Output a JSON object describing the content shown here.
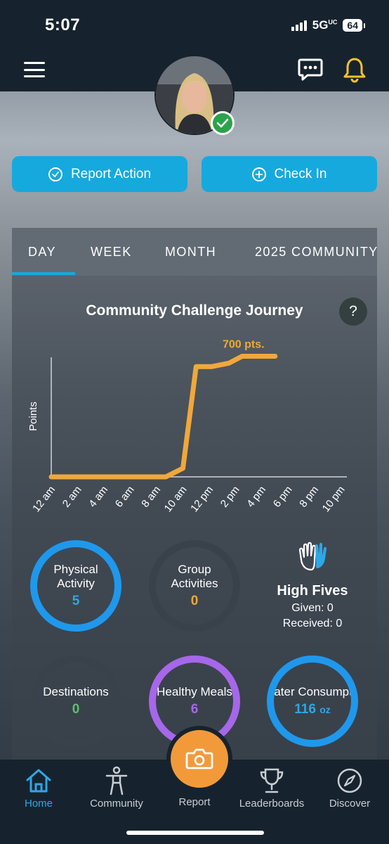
{
  "status": {
    "time": "5:07",
    "network": "5G",
    "network_sup": "UC",
    "battery": "64"
  },
  "header": {
    "menu_icon": "hamburger-icon",
    "chat_icon": "chat-bubble-icon",
    "notification_icon": "bell-icon"
  },
  "actions": {
    "report_label": "Report Action",
    "checkin_label": "Check In"
  },
  "tabs": [
    {
      "label": "DAY",
      "active": true
    },
    {
      "label": "WEEK"
    },
    {
      "label": "MONTH"
    },
    {
      "label": "2025 COMMUNITY"
    }
  ],
  "chart": {
    "title": "Community Challenge Journey",
    "help": "?"
  },
  "chart_data": {
    "type": "line",
    "title": "Community Challenge Journey",
    "xlabel": "",
    "ylabel": "Points",
    "x_ticks": [
      "12 am",
      "2 am",
      "4 am",
      "6 am",
      "8 am",
      "10 am",
      "12 pm",
      "2 pm",
      "4 pm",
      "6 pm",
      "8 pm",
      "10 pm"
    ],
    "x_hours": [
      0,
      8.7,
      10,
      11,
      12.2,
      13.5,
      14.5,
      17
    ],
    "values": [
      0,
      0,
      50,
      640,
      640,
      660,
      700,
      700
    ],
    "annotation": "700 pts.",
    "ylim": [
      0,
      800
    ],
    "xlim": [
      0,
      24
    ],
    "color": "#f0a83b"
  },
  "stats": {
    "physical_activity": {
      "label": "Physical Activity",
      "value": "5"
    },
    "group_activities": {
      "label": "Group Activities",
      "value": "0"
    },
    "destinations": {
      "label": "Destinations",
      "value": "0"
    },
    "healthy_meals": {
      "label": "Healthy Meals",
      "value": "6"
    },
    "water": {
      "label": "Water Consumptio",
      "value": "116",
      "unit": "oz"
    }
  },
  "high_fives": {
    "title": "High Fives",
    "given": "Given: 0",
    "received": "Received: 0",
    "icon": "high-five-icon"
  },
  "nav": [
    {
      "label": "Home",
      "icon": "home-icon"
    },
    {
      "label": "Community",
      "icon": "person-icon"
    },
    {
      "label": "Report",
      "icon": "camera-icon"
    },
    {
      "label": "Leaderboards",
      "icon": "trophy-icon"
    },
    {
      "label": "Discover",
      "icon": "compass-icon"
    }
  ],
  "colors": {
    "accent": "#16a9de",
    "orange": "#f0a83b",
    "green": "#5ec06b",
    "purple": "#a667ea",
    "blue": "#1f98ec",
    "dark": "#16232e"
  }
}
